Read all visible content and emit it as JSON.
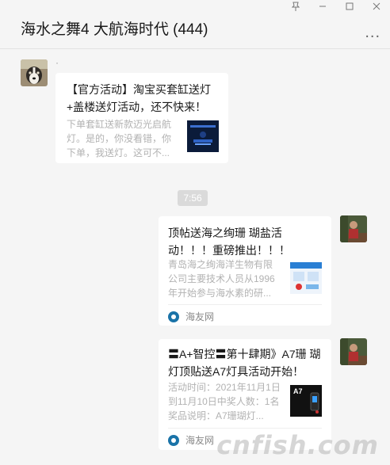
{
  "window": {
    "title": "海水之舞4 大航海时代 (444)",
    "pin_icon": "pin-icon",
    "minimize_icon": "minimize-icon",
    "maximize_icon": "maximize-icon",
    "close_icon": "close-icon",
    "more_label": "..."
  },
  "messages": [
    {
      "sender_name": "·",
      "title": "【官方活动】淘宝买套缸送灯+盖楼送灯活动，还不快来！",
      "desc": "下单套缸送新款迈光启航灯。是的，你没看错，你下单，我送灯。这可不...",
      "source": ""
    },
    {
      "title": "顶帖送海之绚珊 瑚盐活动！！！重磅推出！！！",
      "desc": "青岛海之绚海洋生物有限公司主要技术人员从1996年开始参与海水素的研...",
      "source": "海友网"
    },
    {
      "title": "〓A+智控〓第十肆期》A7珊 瑚灯顶贴送A7灯具活动开始！",
      "desc": "活动时间：2021年11月1日到11月10日中奖人数：1名奖品说明：A7珊瑚灯...",
      "source": "海友网",
      "thumb_text": "A7"
    }
  ],
  "timestamp": "7:56",
  "watermark": "cnfish.com"
}
